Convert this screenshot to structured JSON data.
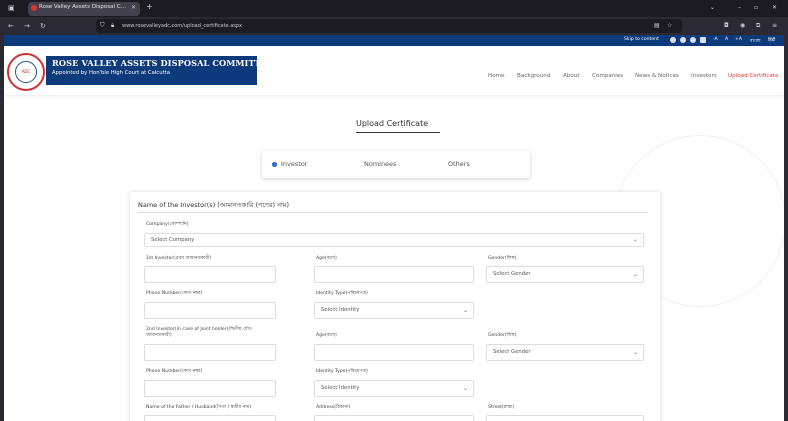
{
  "browser": {
    "tab_title": "Rose Valley Assets Disposal C...",
    "url": "www.rosevalleyadc.com/upload_certificate.aspx"
  },
  "utility_bar": {
    "skip_label": "Skip to content",
    "font_small": "-A",
    "font_normal": "A",
    "font_large": "+A",
    "lang_bengali": "বাংলা",
    "lang_hindi": "हिंदी"
  },
  "header": {
    "logo_text": "ADC",
    "title": "ROSE VALLEY ASSETS DISPOSAL COMMITTEE",
    "subtitle": "Appointed by Hon'ble High Court at Calcutta"
  },
  "nav": {
    "items": [
      "Home",
      "Background",
      "About",
      "Companies",
      "News & Notices",
      "Investors",
      "Upload Certificate"
    ],
    "active_color": "#e53935"
  },
  "page": {
    "title": "Upload Certificate",
    "radio_options": [
      "Investor",
      "Nominees",
      "Others"
    ],
    "selected_radio": "Investor"
  },
  "form": {
    "investor_name_label": "Name of the Investor(s) (আমানতকারি (গণের) নাম)",
    "company_label": "Company(কোম্পানি)",
    "company_value": "Select Company",
    "first_investor_label": "1st Investor(প্রথম আমানতকারী)",
    "age1_label": "Age(বয়স)",
    "gender1_label": "Gender(লিঙ্গ)",
    "gender1_value": "Select Gender",
    "phone1_label": "Phone Number(ফোন নম্বর)",
    "id_type1_label": "Identity Type(পরিচয়পত্র)",
    "id_type1_value": "Select Identity",
    "second_investor_label_1": "2nd Investor(In case of Joint holder)(দ্বিতীয় যৌথ",
    "second_investor_label_2": "আমানতকারী)",
    "age2_label": "Age(বয়স)",
    "gender2_label": "Gender(লিঙ্গ)",
    "gender2_value": "Select Gender",
    "phone2_label": "Phone Number(ফোন নম্বর)",
    "id_type2_label": "Identity Type(পরিচয়পত্র)",
    "id_type2_value": "Select Identity",
    "father_label": "Name of the Father / Husband(পিতা / স্বামীর নাম)",
    "address_label": "Address(ঠিকানা)",
    "street_label": "Street(রাস্তা)"
  }
}
